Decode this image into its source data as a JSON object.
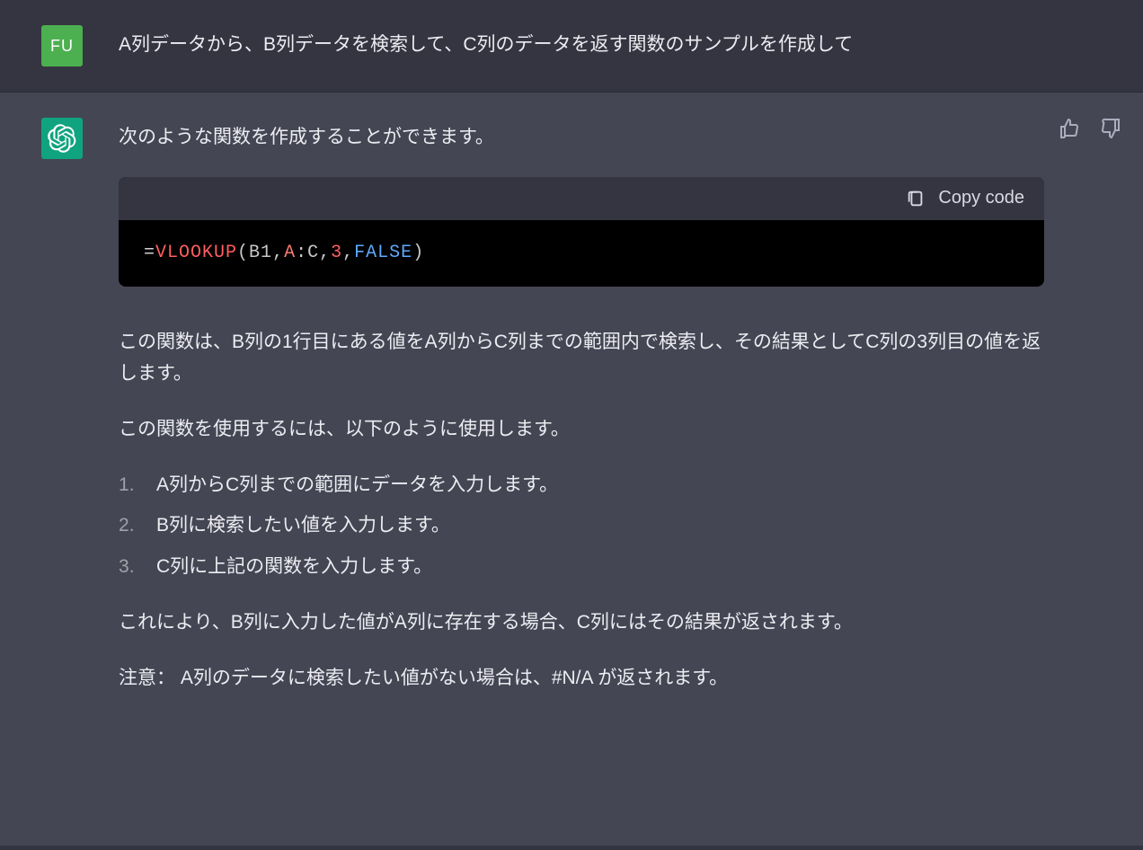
{
  "user": {
    "avatar_text": "FU",
    "message": "A列データから、B列データを検索して、C列のデータを返す関数のサンプルを作成して"
  },
  "assistant": {
    "intro": "次のような関数を作成することができます。",
    "copy_label": "Copy code",
    "code": {
      "eq": "=",
      "fn": "VLOOKUP",
      "open": "(",
      "ref1": "B1",
      "comma1": ",",
      "col1": "A",
      "colon": ":",
      "col2": "C",
      "comma2": ",",
      "num": "3",
      "comma3": ",",
      "kw": "FALSE",
      "close": ")"
    },
    "explain1": "この関数は、B列の1行目にある値をA列からC列までの範囲内で検索し、その結果としてC列の3列目の値を返します。",
    "explain2": "この関数を使用するには、以下のように使用します。",
    "steps": [
      "A列からC列までの範囲にデータを入力します。",
      "B列に検索したい値を入力します。",
      "C列に上記の関数を入力します。"
    ],
    "result": "これにより、B列に入力した値がA列に存在する場合、C列にはその結果が返されます。",
    "note": "注意： A列のデータに検索したい値がない場合は、#N/A が返されます。"
  }
}
